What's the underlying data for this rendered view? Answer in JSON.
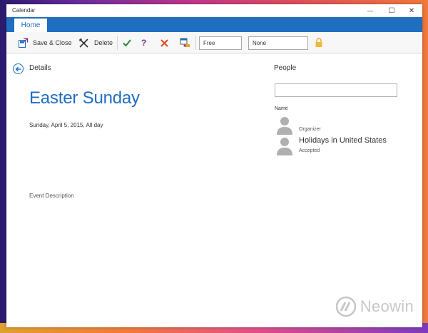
{
  "window": {
    "title": "Calendar",
    "controls": {
      "minimize": "—",
      "maximize": "☐",
      "close": "✕"
    }
  },
  "ribbon": {
    "tabs": [
      {
        "label": "Home",
        "selected": true
      }
    ]
  },
  "toolbar": {
    "save_close_label": "Save & Close",
    "delete_label": "Delete",
    "tentative_label": "?",
    "show_as_value": "Free",
    "reminder_value": "None"
  },
  "details": {
    "section_label": "Details",
    "event_title": "Easter Sunday",
    "event_date": "Sunday, April 5, 2015, All day",
    "description_label": "Event Description"
  },
  "people": {
    "section_label": "People",
    "search_value": "",
    "column_header": "Name",
    "attendees": [
      {
        "name": "",
        "role": "Organizer"
      },
      {
        "name": "Holidays in United States",
        "role": "Accepted"
      }
    ]
  },
  "watermark": {
    "text": "Neowin"
  },
  "colors": {
    "accent": "#1f6ec0",
    "accept": "#2e8b3e",
    "decline": "#e0502a",
    "tentative": "#7a2f9b"
  }
}
